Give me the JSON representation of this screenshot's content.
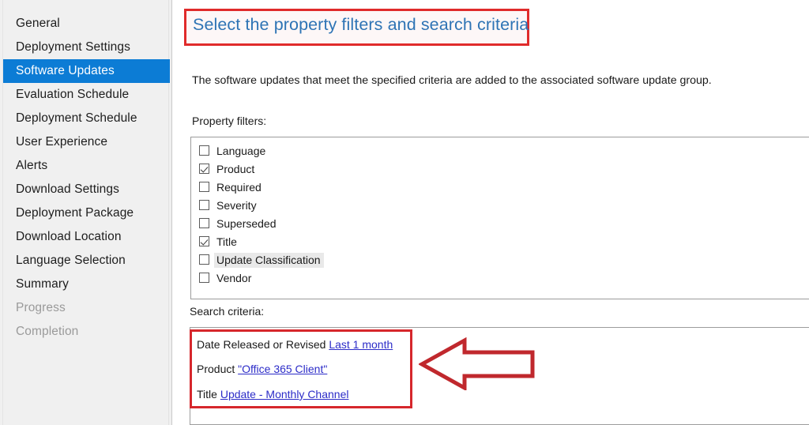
{
  "wizard": {
    "nav_items": [
      {
        "label": "General",
        "state": "normal"
      },
      {
        "label": "Deployment Settings",
        "state": "normal"
      },
      {
        "label": "Software Updates",
        "state": "selected"
      },
      {
        "label": "Evaluation Schedule",
        "state": "normal"
      },
      {
        "label": "Deployment Schedule",
        "state": "normal"
      },
      {
        "label": "User Experience",
        "state": "normal"
      },
      {
        "label": "Alerts",
        "state": "normal"
      },
      {
        "label": "Download Settings",
        "state": "normal"
      },
      {
        "label": "Deployment Package",
        "state": "normal"
      },
      {
        "label": "Download Location",
        "state": "normal"
      },
      {
        "label": "Language Selection",
        "state": "normal"
      },
      {
        "label": "Summary",
        "state": "normal"
      },
      {
        "label": "Progress",
        "state": "disabled"
      },
      {
        "label": "Completion",
        "state": "disabled"
      }
    ]
  },
  "page": {
    "title": "Select the property filters and search criteria",
    "intro": "The software updates that meet the specified criteria are added to the associated software update group.",
    "property_filters_label": "Property filters:",
    "search_criteria_label": "Search criteria:"
  },
  "property_filters": [
    {
      "label": "Language",
      "checked": false,
      "highlighted": false
    },
    {
      "label": "Product",
      "checked": true,
      "highlighted": false
    },
    {
      "label": "Required",
      "checked": false,
      "highlighted": false
    },
    {
      "label": "Severity",
      "checked": false,
      "highlighted": false
    },
    {
      "label": "Superseded",
      "checked": false,
      "highlighted": false
    },
    {
      "label": "Title",
      "checked": true,
      "highlighted": false
    },
    {
      "label": "Update Classification",
      "checked": false,
      "highlighted": true
    },
    {
      "label": "Vendor",
      "checked": false,
      "highlighted": false
    }
  ],
  "search_criteria": [
    {
      "prefix": "Date Released or Revised ",
      "value": "Last 1 month"
    },
    {
      "prefix": "Product ",
      "value": "\"Office 365 Client\""
    },
    {
      "prefix": "Title ",
      "value": "Update - Monthly Channel"
    }
  ],
  "annotations": {
    "title_highlight_color": "#e02b2b",
    "criteria_highlight_color": "#d6272c",
    "arrow_color": "#c0282d",
    "arrow_direction": "left"
  },
  "colors": {
    "selection_blue": "#0c7cd5",
    "heading_blue": "#2e74b5",
    "link_blue": "#2c2cc8",
    "nav_background": "#f0f0f0",
    "disabled_text": "#9a9a9a"
  }
}
